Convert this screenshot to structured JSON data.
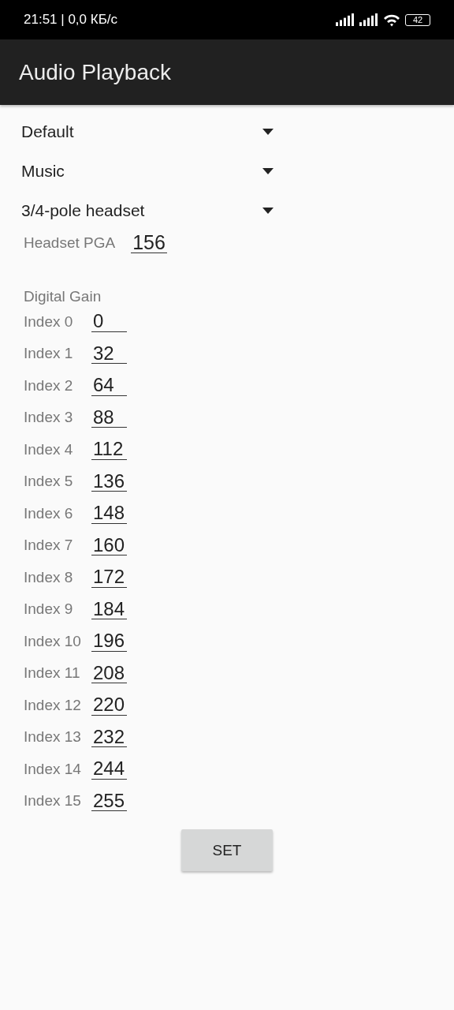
{
  "status_bar": {
    "time": "21:51 | 0,0 КБ/с",
    "battery": "42"
  },
  "app_bar": {
    "title": "Audio Playback"
  },
  "dropdowns": [
    {
      "value": "Default"
    },
    {
      "value": "Music"
    },
    {
      "value": "3/4-pole headset"
    }
  ],
  "headset_pga": {
    "label": "Headset PGA",
    "value": "156"
  },
  "digital_gain": {
    "title": "Digital Gain",
    "rows": [
      {
        "label": "Index 0",
        "value": "0"
      },
      {
        "label": "Index 1",
        "value": "32"
      },
      {
        "label": "Index 2",
        "value": "64"
      },
      {
        "label": "Index 3",
        "value": "88"
      },
      {
        "label": "Index 4",
        "value": "112"
      },
      {
        "label": "Index 5",
        "value": "136"
      },
      {
        "label": "Index 6",
        "value": "148"
      },
      {
        "label": "Index 7",
        "value": "160"
      },
      {
        "label": "Index 8",
        "value": "172"
      },
      {
        "label": "Index 9",
        "value": "184"
      },
      {
        "label": "Index 10",
        "value": "196"
      },
      {
        "label": "Index 11",
        "value": "208"
      },
      {
        "label": "Index 12",
        "value": "220"
      },
      {
        "label": "Index 13",
        "value": "232"
      },
      {
        "label": "Index 14",
        "value": "244"
      },
      {
        "label": "Index 15",
        "value": "255"
      }
    ]
  },
  "buttons": [
    "SET"
  ]
}
